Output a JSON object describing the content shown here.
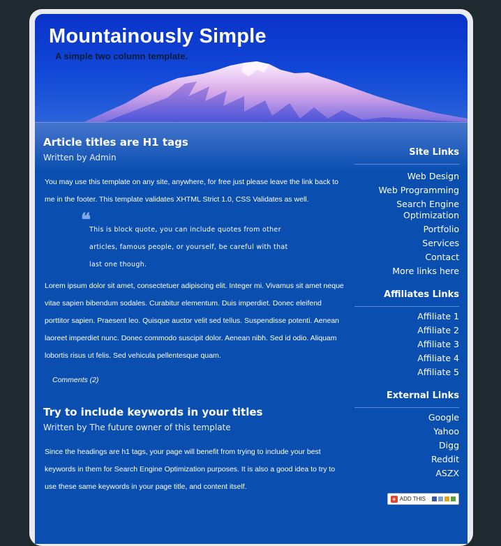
{
  "header": {
    "title": "Mountainously Simple",
    "tagline": "A simple two column template."
  },
  "articles": [
    {
      "title": "Article titles are H1 tags",
      "byline": "Written by Admin",
      "intro": "You may use this template on any site, anywhere, for free just please leave the link back to me in the footer. This template validates XHTML Strict 1.0, CSS Validates as well.",
      "quote": "This is block quote, you can include quotes from other articles, famous people, or yourself, be careful with that last one though.",
      "body": "Lorem ipsum dolor sit amet, consectetuer adipiscing elit. Integer mi. Vivamus sit amet neque vitae sapien bibendum sodales. Curabitur elementum. Duis imperdiet. Donec eleifend porttitor sapien. Praesent leo. Quisque auctor velit sed tellus. Suspendisse potenti. Aenean laoreet imperdiet nunc. Donec commodo suscipit dolor. Aenean nibh. Sed id odio. Aliquam lobortis risus ut felis. Sed vehicula pellentesque quam.",
      "comments": "Comments (2)"
    },
    {
      "title": "Try to include keywords in your titles",
      "byline": "Written by The future owner of this template",
      "intro": "Since the headings are h1 tags, your page will benefit from trying to include your best keywords in them for Search Engine Optimization purposes. It is also a good idea to try to use these same keywords in your page title, and content itself."
    }
  ],
  "sidebar": {
    "site_links": {
      "title": "Site Links",
      "items": [
        "Web Design",
        "Web Programming",
        "Search Engine Optimization",
        "Portfolio",
        "Services",
        "Contact",
        "More links here"
      ]
    },
    "affiliate_links": {
      "title": "Affiliates Links",
      "items": [
        "Affiliate 1",
        "Affiliate 2",
        "Affiliate 3",
        "Affiliate 4",
        "Affiliate 5"
      ]
    },
    "external_links": {
      "title": "External Links",
      "items": [
        "Google",
        "Yahoo",
        "Digg",
        "Reddit",
        "ASZX"
      ]
    },
    "share_button": {
      "label": "ADD THIS",
      "icon": "addthis-plus-icon"
    }
  },
  "colors": {
    "page_background": "#1e2930",
    "content_blue": "#0a4fb0",
    "frame": "#e9ecef",
    "text": "#ffffff"
  }
}
